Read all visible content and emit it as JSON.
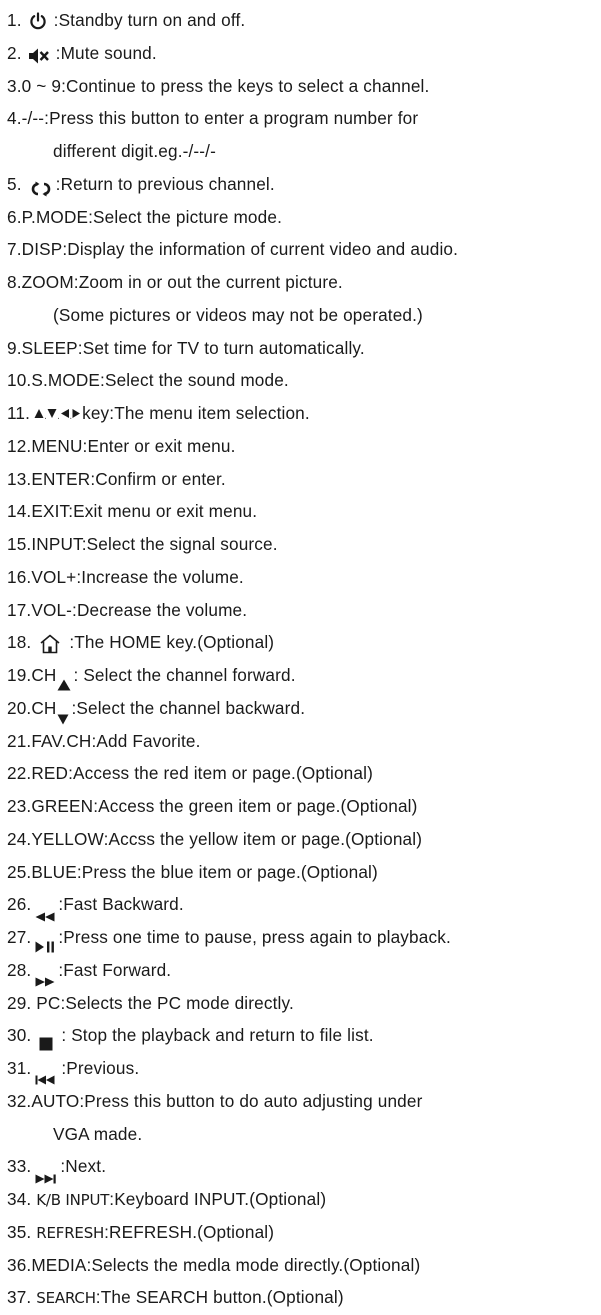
{
  "items": {
    "i1": {
      "num": "1.",
      "text": ":Standby turn on and off."
    },
    "i2": {
      "num": "2.",
      "text": ":Mute sound."
    },
    "i3": {
      "text": "3.0 ~ 9:Continue to press the keys to select a channel."
    },
    "i4": {
      "text": "4.-/--:Press this button to enter a program number for",
      "cont": "different digit.eg.-/--/-"
    },
    "i5": {
      "num": "5.",
      "text": ":Return to previous channel."
    },
    "i6": {
      "text": "6.P.MODE:Select the picture mode."
    },
    "i7": {
      "text": "7.DISP:Display the information of current video and audio."
    },
    "i8": {
      "text": "8.ZOOM:Zoom in or out the current picture.",
      "cont": "(Some pictures or videos may not be operated.)"
    },
    "i9": {
      "text": "9.SLEEP:Set time for TV to turn automatically."
    },
    "i10": {
      "text": "10.S.MODE:Select the sound mode."
    },
    "i11": {
      "num": "11.",
      "text": "key:The menu item selection."
    },
    "i12": {
      "text": "12.MENU:Enter or exit menu."
    },
    "i13": {
      "text": "13.ENTER:Confirm or enter."
    },
    "i14": {
      "text": "14.EXIT:Exit menu or exit menu."
    },
    "i15": {
      "text": "15.INPUT:Select the signal source."
    },
    "i16": {
      "text": "16.VOL+:Increase the volume."
    },
    "i17": {
      "text": "17.VOL-:Decrease the volume."
    },
    "i18": {
      "num": "18.",
      "text": ":The HOME key.(Optional)"
    },
    "i19": {
      "num": "19.CH",
      "text": ": Select the channel forward."
    },
    "i20": {
      "num": "20.CH",
      "text": ":Select the channel backward."
    },
    "i21": {
      "text": "21.FAV.CH:Add Favorite."
    },
    "i22": {
      "text": "22.RED:Access the red item or page.(Optional)"
    },
    "i23": {
      "text": "23.GREEN:Access the green item or page.(Optional)"
    },
    "i24": {
      "text": "24.YELLOW:Accss the yellow item or page.(Optional)"
    },
    "i25": {
      "text": "25.BLUE:Press  the blue item or page.(Optional)"
    },
    "i26": {
      "num": "26.",
      "text": ":Fast Backward."
    },
    "i27": {
      "num": "27.",
      "text": ":Press one time to pause, press again to playback."
    },
    "i28": {
      "num": "28.",
      "text": ":Fast Forward."
    },
    "i29": {
      "text": "29. PC:Selects the PC mode directly."
    },
    "i30": {
      "num": "30.",
      "text": ": Stop the playback and return to file list."
    },
    "i31": {
      "num": "31.",
      "text": ":Previous."
    },
    "i32": {
      "text": "32.AUTO:Press this button to do auto adjusting under",
      "cont": "VGA made."
    },
    "i33": {
      "num": "33.",
      "text": ":Next."
    },
    "i34": {
      "num": "34.",
      "key": "K/B INPUT",
      "text": ":Keyboard INPUT.(Optional)"
    },
    "i35": {
      "num": "35.",
      "key": "REFRESH",
      "text": ":REFRESH.(Optional)"
    },
    "i36": {
      "text": "36.MEDIA:Selects the medla mode directly.(Optional)"
    },
    "i37": {
      "num": "37.",
      "key": "SEARCH",
      "text": ":The SEARCH button.(Optional)"
    }
  },
  "icons": {
    "i1": "power-icon",
    "i2": "mute-icon",
    "i5": "return-icon",
    "i11": "arrow-keys-icon",
    "i18": "home-icon",
    "i19": "triangle-up-icon",
    "i20": "triangle-down-icon",
    "i26": "fast-backward-icon",
    "i27": "play-pause-icon",
    "i28": "fast-forward-icon",
    "i30": "stop-icon",
    "i31": "previous-icon",
    "i33": "next-icon"
  },
  "colors": {
    "text": "#1a1a1a",
    "background": "#ffffff"
  }
}
